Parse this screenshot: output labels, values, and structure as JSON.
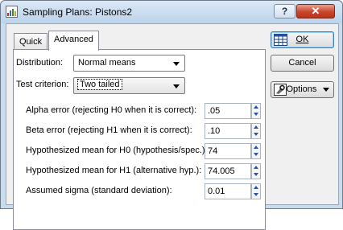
{
  "window": {
    "title": "Sampling Plans: Pistons2",
    "help_label": "?",
    "close_label": "✕"
  },
  "tabs": [
    {
      "label": "Quick"
    },
    {
      "label": "Advanced"
    }
  ],
  "distribution": {
    "label": "Distribution:",
    "value": "Normal means"
  },
  "test_criterion": {
    "label": "Test criterion:",
    "value": "Two tailed"
  },
  "fields": [
    {
      "label": "Alpha error (rejecting H0 when it is correct):",
      "value": ".05"
    },
    {
      "label": "Beta error (rejecting H1 when it is correct):",
      "value": ".10"
    },
    {
      "label": "Hypothesized mean for H0 (hypothesis/spec.):",
      "value": "74"
    },
    {
      "label": "Hypothesized mean for H1 (alternative hyp.):",
      "value": "74.005"
    },
    {
      "label": "Assumed sigma (standard deviation):",
      "value": "0.01"
    }
  ],
  "buttons": {
    "ok": "OK",
    "cancel": "Cancel",
    "options": "Options"
  },
  "colors": {
    "titlebar": "#c9dcee",
    "close": "#c8452c",
    "spin_arrow": "#2a52a0"
  }
}
